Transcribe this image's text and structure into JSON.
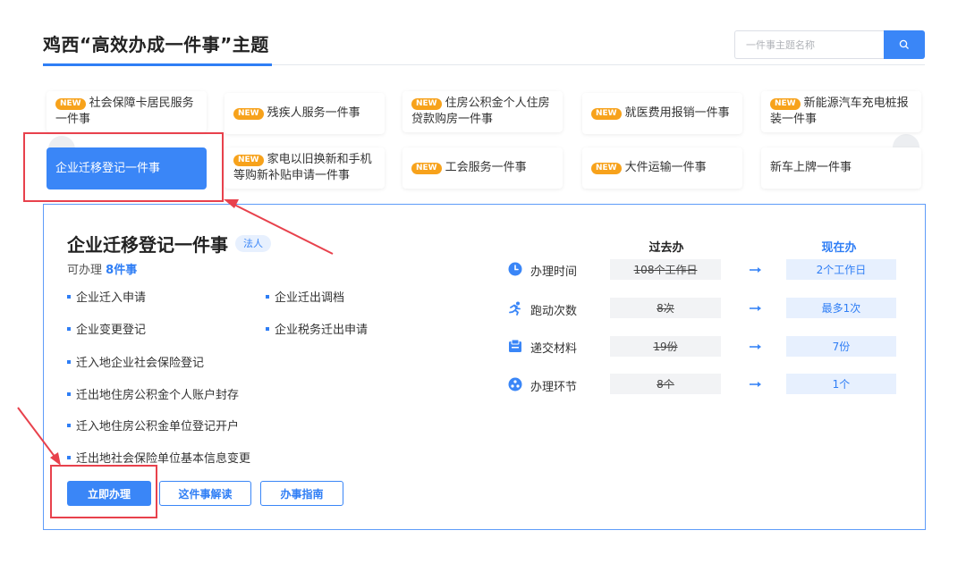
{
  "header": {
    "title": "鸡西“高效办成一件事”主题",
    "search_placeholder": "一件事主题名称"
  },
  "topics": {
    "badge_label": "NEW",
    "row1": [
      {
        "label_line1": "社会保障卡居民服务",
        "label_line2": "一件事",
        "is_new": true
      },
      {
        "label_line1": "残疾人服务一件事",
        "label_line2": "",
        "is_new": true
      },
      {
        "label_line1": "住房公积金个人住房",
        "label_line2": "贷款购房一件事",
        "is_new": true
      },
      {
        "label_line1": "就医费用报销一件事",
        "label_line2": "",
        "is_new": true
      },
      {
        "label_line1": "新能源汽车充电桩报",
        "label_line2": "装一件事",
        "is_new": true
      }
    ],
    "row2": [
      {
        "label_line1": "企业迁移登记一件事",
        "label_line2": "",
        "is_new": false,
        "selected": true
      },
      {
        "label_line1": "家电以旧换新和手机",
        "label_line2": "等购新补贴申请一件事",
        "is_new": true
      },
      {
        "label_line1": "工会服务一件事",
        "label_line2": "",
        "is_new": true
      },
      {
        "label_line1": "大件运输一件事",
        "label_line2": "",
        "is_new": true
      },
      {
        "label_line1": "新车上牌一件事",
        "label_line2": "",
        "is_new": false
      }
    ]
  },
  "detail": {
    "title": "企业迁移登记一件事",
    "tag": "法人",
    "count_prefix": "可办理",
    "count_value": "8件事",
    "items": [
      "企业迁入申请",
      "企业迁出调档",
      "企业变更登记",
      "企业税务迁出申请",
      "迁入地企业社会保险登记",
      "迁出地住房公积金个人账户封存",
      "迁入地住房公积金单位登记开户",
      "迁出地社会保险单位基本信息变更"
    ],
    "buttons": {
      "apply": "立即办理",
      "explain": "这件事解读",
      "guide": "办事指南"
    },
    "comparison": {
      "past_header": "过去办",
      "now_header": "现在办",
      "rows": [
        {
          "label": "办理时间",
          "icon": "clock-icon",
          "past": "108个工作日",
          "now": "2个工作日"
        },
        {
          "label": "跑动次数",
          "icon": "running-icon",
          "past": "8次",
          "now": "最多1次"
        },
        {
          "label": "递交材料",
          "icon": "folder-icon",
          "past": "19份",
          "now": "7份"
        },
        {
          "label": "办理环节",
          "icon": "steps-icon",
          "past": "8个",
          "now": "1个"
        }
      ]
    }
  },
  "colors": {
    "accent": "#3a86f7",
    "badge": "#f7a21b",
    "annotation": "#e8414c"
  }
}
